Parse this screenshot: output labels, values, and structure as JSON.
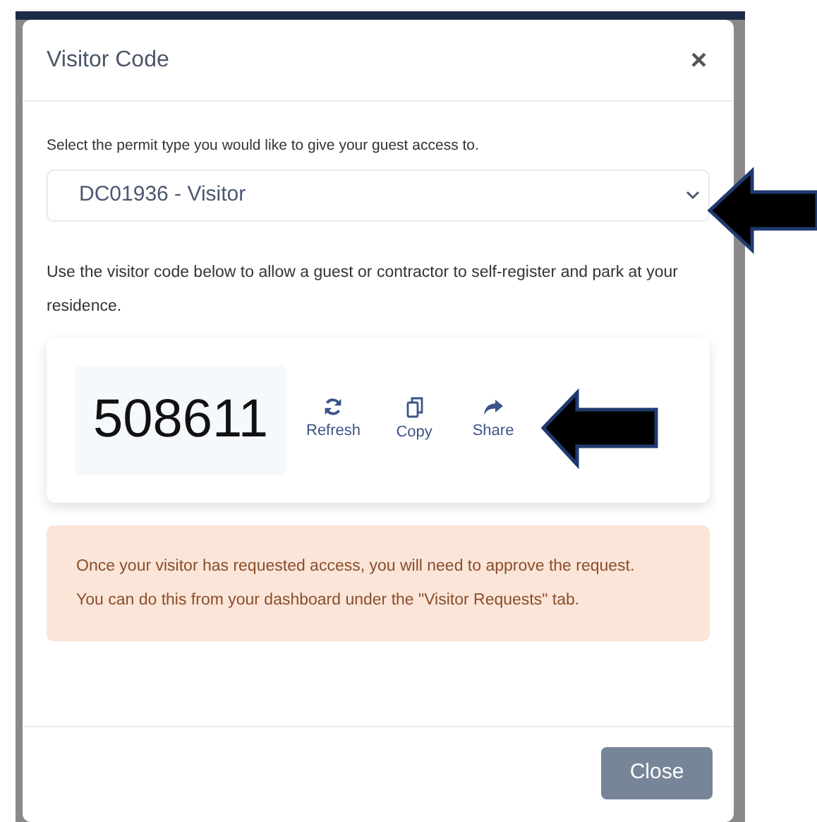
{
  "modal": {
    "title": "Visitor Code",
    "close_symbol": "×"
  },
  "permit_label": "Select the permit type you would like to give your guest access to.",
  "permit_select": {
    "value": "DC01936 - Visitor"
  },
  "description": "Use the visitor code below to allow a guest or contractor to self-register and park at your residence.",
  "visitor_code": "508611",
  "actions": [
    {
      "label": "Refresh",
      "kind": "refresh"
    },
    {
      "label": "Copy",
      "kind": "copy"
    },
    {
      "label": "Share",
      "kind": "share"
    }
  ],
  "alert": "Once your visitor has requested access, you will need to approve the request. You can do this from your dashboard under the \"Visitor Requests\" tab.",
  "footer_button": "Close"
}
